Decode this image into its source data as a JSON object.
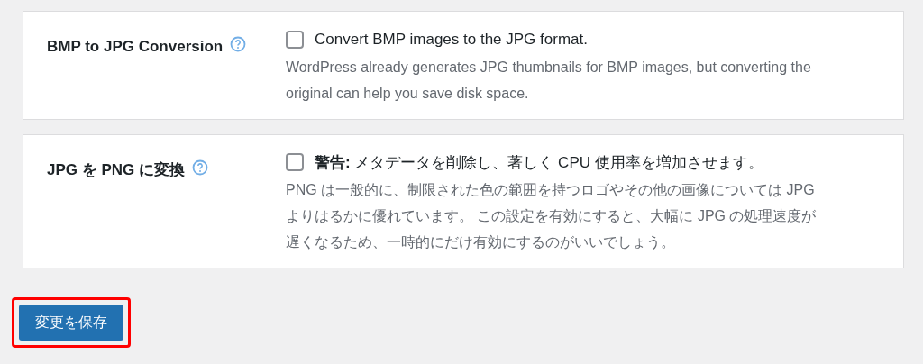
{
  "settings": [
    {
      "label": "BMP to JPG Conversion",
      "checkbox": {
        "text": "Convert BMP images to the JPG format.",
        "checked": false
      },
      "description": "WordPress already generates JPG thumbnails for BMP images, but converting the original can help you save disk space."
    },
    {
      "label": "JPG を PNG に変換",
      "checkbox": {
        "text": "**警告:** メタデータを削除し、著しく CPU 使用率を増加させます。",
        "checked": false
      },
      "description": "PNG は一般的に、制限された色の範囲を持つロゴやその他の画像については JPG よりはるかに優れています。 この設定を有効にすると、大幅に JPG の処理速度が遅くなるため、一時的にだけ有効にするのがいいでしょう。"
    }
  ],
  "save_button": {
    "label": "変更を保存",
    "highlighted": true
  }
}
